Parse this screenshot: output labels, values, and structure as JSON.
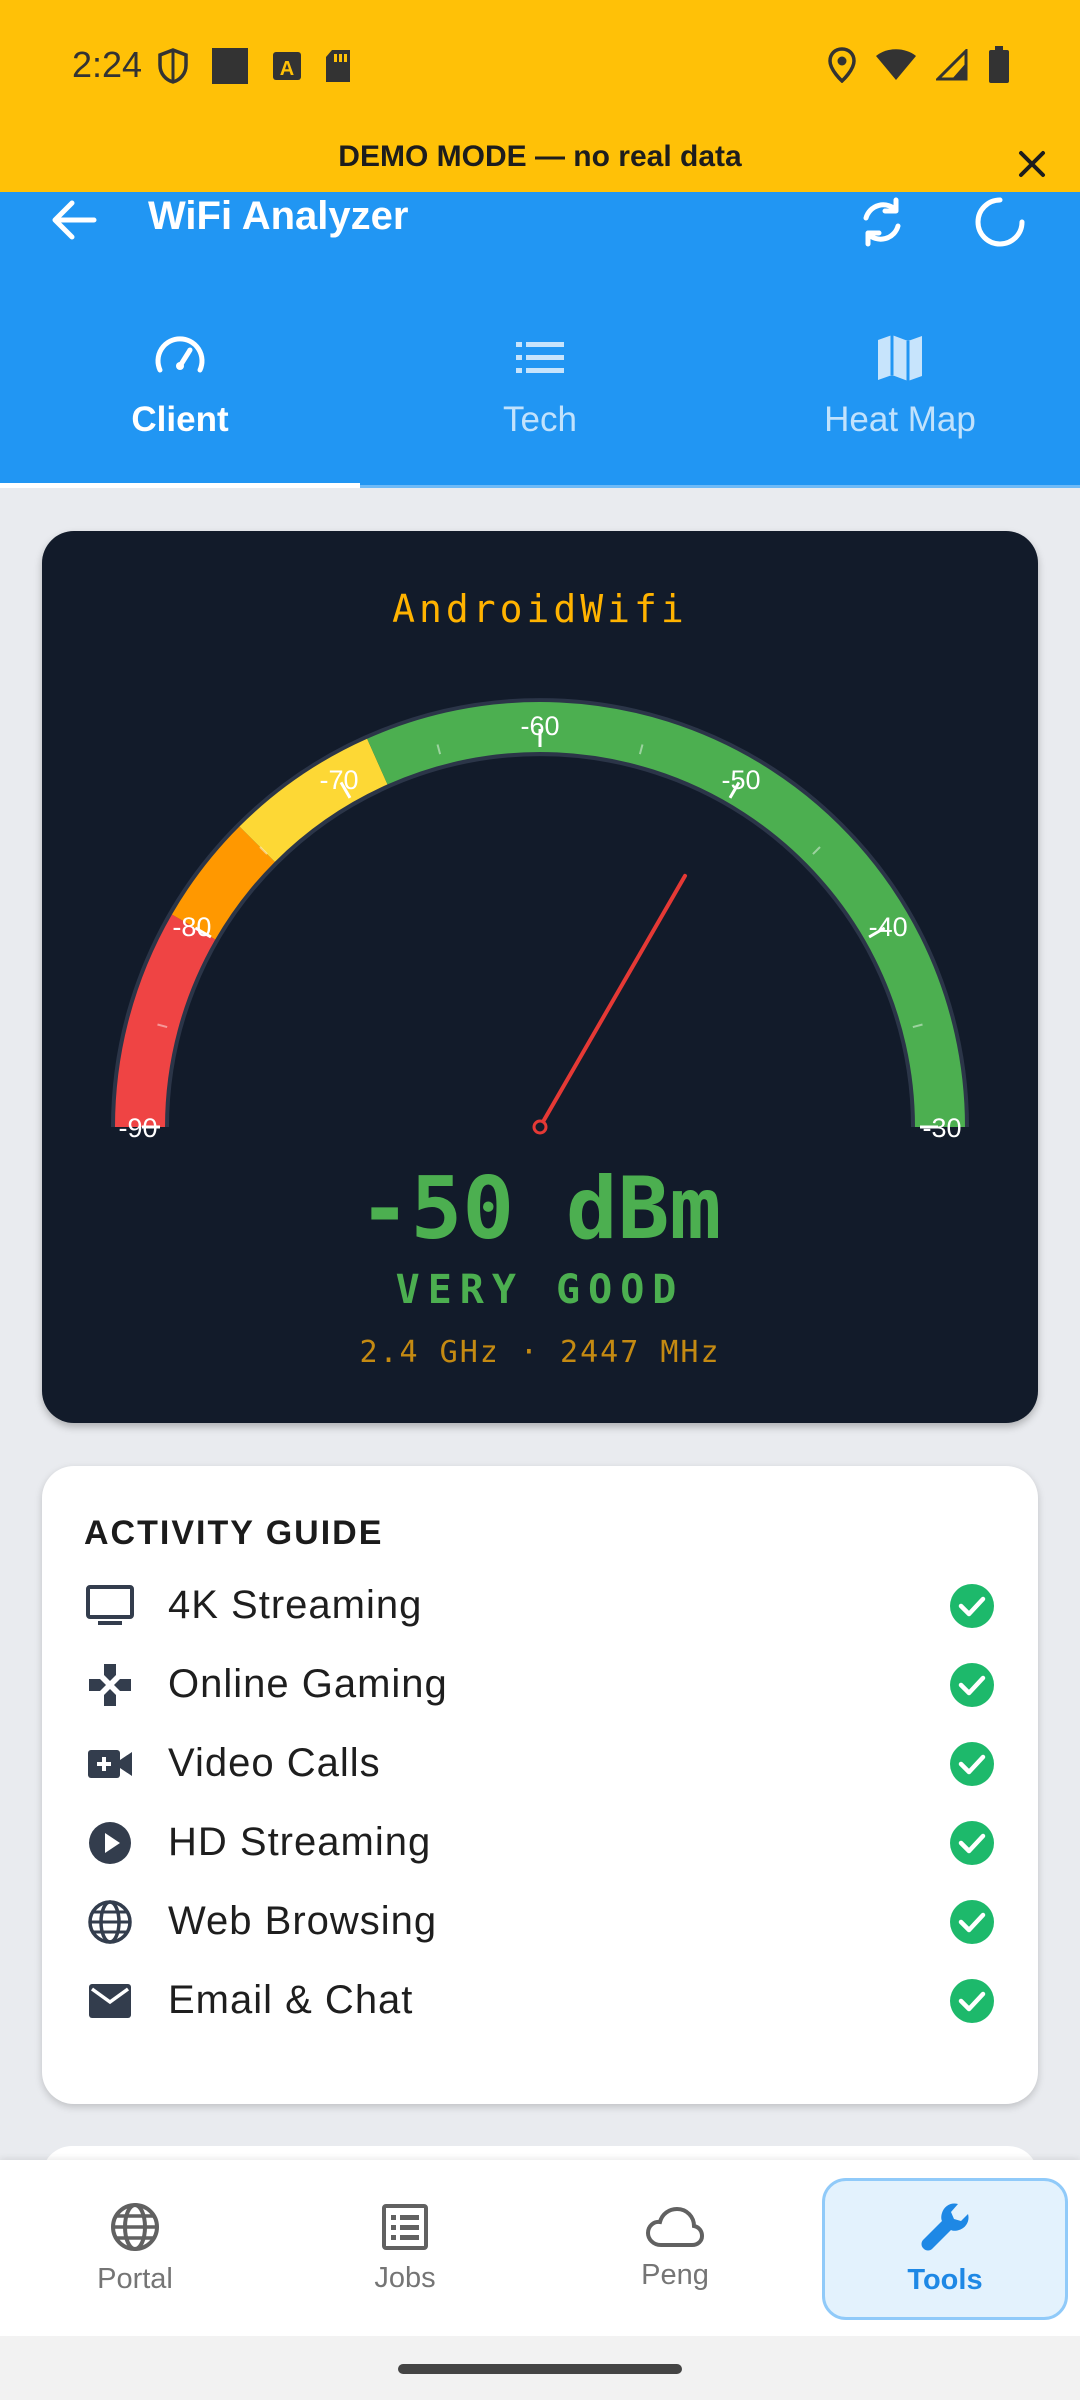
{
  "status_bar": {
    "time": "2:24",
    "left_icons": [
      "shield-icon",
      "square-icon",
      "font-icon",
      "sd-card-icon"
    ],
    "right_icons": [
      "location-icon",
      "wifi-icon",
      "signal-icon",
      "battery-icon"
    ],
    "background": "#ffc107"
  },
  "demo_banner": {
    "text": "DEMO MODE — no real data"
  },
  "appbar": {
    "title": "WiFi Analyzer",
    "background": "#2196f3",
    "tabs": [
      {
        "label": "Client",
        "icon": "speedometer-icon",
        "active": true
      },
      {
        "label": "Tech",
        "icon": "list-icon",
        "active": false
      },
      {
        "label": "Heat Map",
        "icon": "map-icon",
        "active": false
      }
    ]
  },
  "gauge": {
    "ssid": "AndroidWifi",
    "value_text": "-50 dBm",
    "quality": "VERY GOOD",
    "frequency": "2.4 GHz · 2447 MHz",
    "min": -90,
    "max": -30,
    "value": -50,
    "tick_labels": [
      "-90",
      "-80",
      "-70",
      "-60",
      "-50",
      "-40",
      "-30"
    ],
    "colors": {
      "red": "#ef4444",
      "orange": "#ff9800",
      "yellow": "#fdd835",
      "green": "#4caf50",
      "needle": "#e53935"
    }
  },
  "activity_guide": {
    "title": "ACTIVITY GUIDE",
    "items": [
      {
        "label": "4K Streaming",
        "icon": "monitor-icon",
        "ok": true
      },
      {
        "label": "Online Gaming",
        "icon": "gamepad-icon",
        "ok": true
      },
      {
        "label": "Video Calls",
        "icon": "video-call-icon",
        "ok": true
      },
      {
        "label": "HD Streaming",
        "icon": "play-circle-icon",
        "ok": true
      },
      {
        "label": "Web Browsing",
        "icon": "globe-icon",
        "ok": true
      },
      {
        "label": "Email & Chat",
        "icon": "mail-icon",
        "ok": true
      }
    ],
    "check_color": "#1db96b"
  },
  "bottom_nav": {
    "items": [
      {
        "label": "Portal",
        "icon": "globe-icon",
        "active": false
      },
      {
        "label": "Jobs",
        "icon": "list-box-icon",
        "active": false
      },
      {
        "label": "Peng",
        "icon": "cloud-icon",
        "active": false
      },
      {
        "label": "Tools",
        "icon": "wrench-icon",
        "active": true
      }
    ]
  }
}
